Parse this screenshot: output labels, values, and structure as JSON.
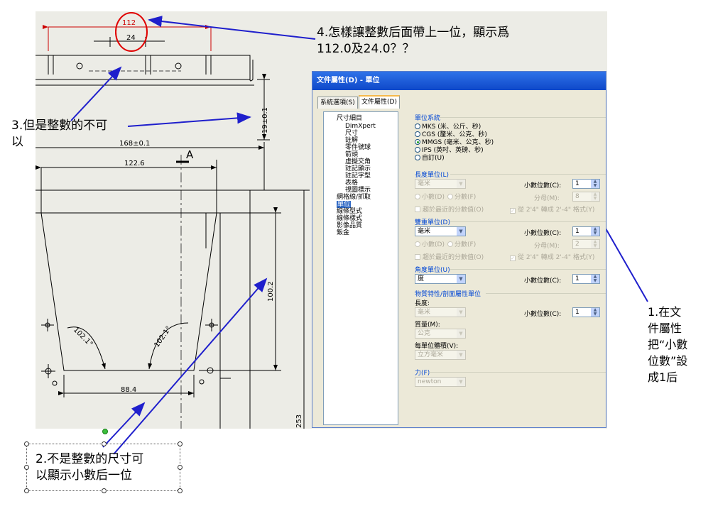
{
  "annotations": {
    "note4_line1": "4.怎樣讓整數后面帶上一位，顯示爲",
    "note4_line2": "112.0及24.0？？",
    "note3_line1": "3.但是整數的不可",
    "note3_line2": "以",
    "note2_line1": "2.不是整數的尺寸可",
    "note2_line2": "以顯示小數后一位",
    "note1_line1": "1.在文",
    "note1_line2": "件屬性",
    "note1_line3": "把“小數",
    "note1_line4": "位數”設",
    "note1_line5": "成1后",
    "arrow_color": "#1f1fcc",
    "circle_color": "#e00000"
  },
  "drawing": {
    "dim_112": "112",
    "dim_24": "24",
    "dim_19": "19±0.1",
    "dim_168": "168±0.1",
    "dim_122_6": "122.6",
    "section_label": "A",
    "dim_100_2": "100.2",
    "angle_left": "102.1°",
    "angle_right": "102.1°",
    "dim_88_4": "88.4",
    "dim_253": "253",
    "red_dim_color": "#cc0000"
  },
  "dialog": {
    "title": "文件屬性(D) - 單位",
    "tab_system": "系統選項(S)",
    "tab_document": "文件屬性(D)",
    "tree": [
      "尺寸細目",
      "DimXpert",
      "尺寸",
      "註解",
      "零件號球",
      "箭頭",
      "虛擬交角",
      "註記顯示",
      "註記字型",
      "表格",
      "視圖標示",
      "網格線/抓取",
      "單位",
      "線條型式",
      "線條樣式",
      "影像品質",
      "鈑金"
    ],
    "unit_system_label": "單位系統",
    "unit_options": [
      "MKS (米、公斤、秒)",
      "CGS (釐米、公克、秒)",
      "MMGS (毫米、公克、秒)",
      "IPS (英吋、英磅、秒)",
      "自訂(U)"
    ],
    "unit_selected": "MMGS (毫米、公克、秒)",
    "length_unit_label": "長度單位(L)",
    "length_unit_value": "毫米",
    "decimals_label": "小數位數(C):",
    "length_decimals": "1",
    "decimal_radio": "小數(D)",
    "fraction_radio": "分數(F)",
    "denominator_label": "分母(M):",
    "length_denominator": "8",
    "round_nearest": "趨於最近的分數值(O)",
    "convert_2_4": "從 2'4\" 轉成 2'-4\" 格式(Y)",
    "dual_unit_label": "雙重單位(D)",
    "dual_unit_value": "毫米",
    "dual_decimals": "1",
    "dual_denominator": "2",
    "angle_unit_label": "角度單位(U)",
    "angle_unit_value": "度",
    "angle_decimals": "1",
    "mass_section_label": "物質特性/剖面屬性單位",
    "mass_length_label": "長度:",
    "mass_length_value": "毫米",
    "mass_decimals": "1",
    "mass_label": "質量(M):",
    "mass_value": "公克",
    "volume_label": "每單位體積(V):",
    "volume_value": "立方毫米",
    "force_label": "力(F)",
    "force_value": "newton"
  }
}
